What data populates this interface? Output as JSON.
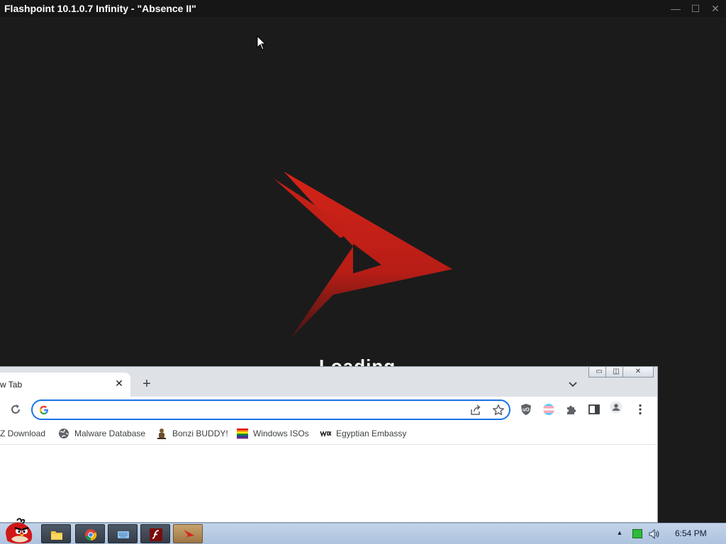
{
  "flashpoint": {
    "title": "Flashpoint 10.1.0.7 Infinity - \"Absence II\"",
    "minimize_glyph": "—",
    "maximize_glyph": "☐",
    "close_glyph": "✕",
    "loading_text": "Loading",
    "logo_color": "#d0201a"
  },
  "chrome": {
    "tab_title": "w Tab",
    "tab_close_glyph": "✕",
    "new_tab_glyph": "+",
    "omnibox_value": "",
    "win_minimize_glyph": "▭",
    "win_restore_glyph": "◫",
    "win_close_glyph": "✕",
    "bookmarks": [
      {
        "label": "Z Download",
        "icon": "download-icon"
      },
      {
        "label": "Malware Database",
        "icon": "globe-icon"
      },
      {
        "label": "Bonzi BUDDY!",
        "icon": "bonzi-icon"
      },
      {
        "label": "Windows ISOs",
        "icon": "rainbow-flag-icon"
      },
      {
        "label": "Egyptian Embassy",
        "icon": "wix-icon"
      }
    ],
    "accent_color": "#1a73e8"
  },
  "taskbar": {
    "clock": "6:54 PM",
    "tray_arrow_glyph": "▲",
    "apps": [
      {
        "name": "file-explorer",
        "icon": "folder-icon",
        "active": false
      },
      {
        "name": "chrome",
        "icon": "chrome-icon",
        "active": false
      },
      {
        "name": "on-screen-keyboard",
        "icon": "keyboard-icon",
        "active": false
      },
      {
        "name": "flash-player",
        "icon": "flash-icon",
        "active": false
      },
      {
        "name": "flashpoint",
        "icon": "flashpoint-icon",
        "active": true
      }
    ]
  }
}
